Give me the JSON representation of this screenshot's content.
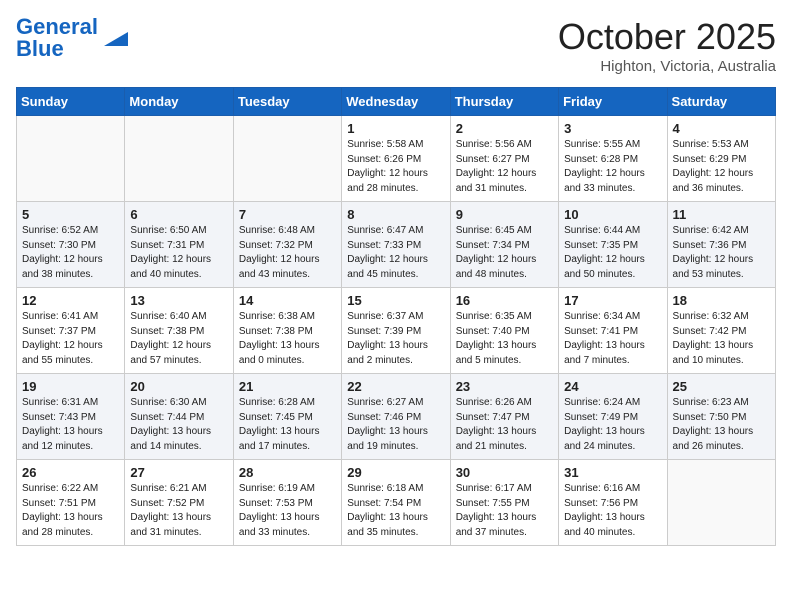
{
  "header": {
    "logo_general": "General",
    "logo_blue": "Blue",
    "month": "October 2025",
    "location": "Highton, Victoria, Australia"
  },
  "days_of_week": [
    "Sunday",
    "Monday",
    "Tuesday",
    "Wednesday",
    "Thursday",
    "Friday",
    "Saturday"
  ],
  "weeks": [
    [
      {
        "day": "",
        "info": ""
      },
      {
        "day": "",
        "info": ""
      },
      {
        "day": "",
        "info": ""
      },
      {
        "day": "1",
        "info": "Sunrise: 5:58 AM\nSunset: 6:26 PM\nDaylight: 12 hours\nand 28 minutes."
      },
      {
        "day": "2",
        "info": "Sunrise: 5:56 AM\nSunset: 6:27 PM\nDaylight: 12 hours\nand 31 minutes."
      },
      {
        "day": "3",
        "info": "Sunrise: 5:55 AM\nSunset: 6:28 PM\nDaylight: 12 hours\nand 33 minutes."
      },
      {
        "day": "4",
        "info": "Sunrise: 5:53 AM\nSunset: 6:29 PM\nDaylight: 12 hours\nand 36 minutes."
      }
    ],
    [
      {
        "day": "5",
        "info": "Sunrise: 6:52 AM\nSunset: 7:30 PM\nDaylight: 12 hours\nand 38 minutes."
      },
      {
        "day": "6",
        "info": "Sunrise: 6:50 AM\nSunset: 7:31 PM\nDaylight: 12 hours\nand 40 minutes."
      },
      {
        "day": "7",
        "info": "Sunrise: 6:48 AM\nSunset: 7:32 PM\nDaylight: 12 hours\nand 43 minutes."
      },
      {
        "day": "8",
        "info": "Sunrise: 6:47 AM\nSunset: 7:33 PM\nDaylight: 12 hours\nand 45 minutes."
      },
      {
        "day": "9",
        "info": "Sunrise: 6:45 AM\nSunset: 7:34 PM\nDaylight: 12 hours\nand 48 minutes."
      },
      {
        "day": "10",
        "info": "Sunrise: 6:44 AM\nSunset: 7:35 PM\nDaylight: 12 hours\nand 50 minutes."
      },
      {
        "day": "11",
        "info": "Sunrise: 6:42 AM\nSunset: 7:36 PM\nDaylight: 12 hours\nand 53 minutes."
      }
    ],
    [
      {
        "day": "12",
        "info": "Sunrise: 6:41 AM\nSunset: 7:37 PM\nDaylight: 12 hours\nand 55 minutes."
      },
      {
        "day": "13",
        "info": "Sunrise: 6:40 AM\nSunset: 7:38 PM\nDaylight: 12 hours\nand 57 minutes."
      },
      {
        "day": "14",
        "info": "Sunrise: 6:38 AM\nSunset: 7:38 PM\nDaylight: 13 hours\nand 0 minutes."
      },
      {
        "day": "15",
        "info": "Sunrise: 6:37 AM\nSunset: 7:39 PM\nDaylight: 13 hours\nand 2 minutes."
      },
      {
        "day": "16",
        "info": "Sunrise: 6:35 AM\nSunset: 7:40 PM\nDaylight: 13 hours\nand 5 minutes."
      },
      {
        "day": "17",
        "info": "Sunrise: 6:34 AM\nSunset: 7:41 PM\nDaylight: 13 hours\nand 7 minutes."
      },
      {
        "day": "18",
        "info": "Sunrise: 6:32 AM\nSunset: 7:42 PM\nDaylight: 13 hours\nand 10 minutes."
      }
    ],
    [
      {
        "day": "19",
        "info": "Sunrise: 6:31 AM\nSunset: 7:43 PM\nDaylight: 13 hours\nand 12 minutes."
      },
      {
        "day": "20",
        "info": "Sunrise: 6:30 AM\nSunset: 7:44 PM\nDaylight: 13 hours\nand 14 minutes."
      },
      {
        "day": "21",
        "info": "Sunrise: 6:28 AM\nSunset: 7:45 PM\nDaylight: 13 hours\nand 17 minutes."
      },
      {
        "day": "22",
        "info": "Sunrise: 6:27 AM\nSunset: 7:46 PM\nDaylight: 13 hours\nand 19 minutes."
      },
      {
        "day": "23",
        "info": "Sunrise: 6:26 AM\nSunset: 7:47 PM\nDaylight: 13 hours\nand 21 minutes."
      },
      {
        "day": "24",
        "info": "Sunrise: 6:24 AM\nSunset: 7:49 PM\nDaylight: 13 hours\nand 24 minutes."
      },
      {
        "day": "25",
        "info": "Sunrise: 6:23 AM\nSunset: 7:50 PM\nDaylight: 13 hours\nand 26 minutes."
      }
    ],
    [
      {
        "day": "26",
        "info": "Sunrise: 6:22 AM\nSunset: 7:51 PM\nDaylight: 13 hours\nand 28 minutes."
      },
      {
        "day": "27",
        "info": "Sunrise: 6:21 AM\nSunset: 7:52 PM\nDaylight: 13 hours\nand 31 minutes."
      },
      {
        "day": "28",
        "info": "Sunrise: 6:19 AM\nSunset: 7:53 PM\nDaylight: 13 hours\nand 33 minutes."
      },
      {
        "day": "29",
        "info": "Sunrise: 6:18 AM\nSunset: 7:54 PM\nDaylight: 13 hours\nand 35 minutes."
      },
      {
        "day": "30",
        "info": "Sunrise: 6:17 AM\nSunset: 7:55 PM\nDaylight: 13 hours\nand 37 minutes."
      },
      {
        "day": "31",
        "info": "Sunrise: 6:16 AM\nSunset: 7:56 PM\nDaylight: 13 hours\nand 40 minutes."
      },
      {
        "day": "",
        "info": ""
      }
    ]
  ]
}
